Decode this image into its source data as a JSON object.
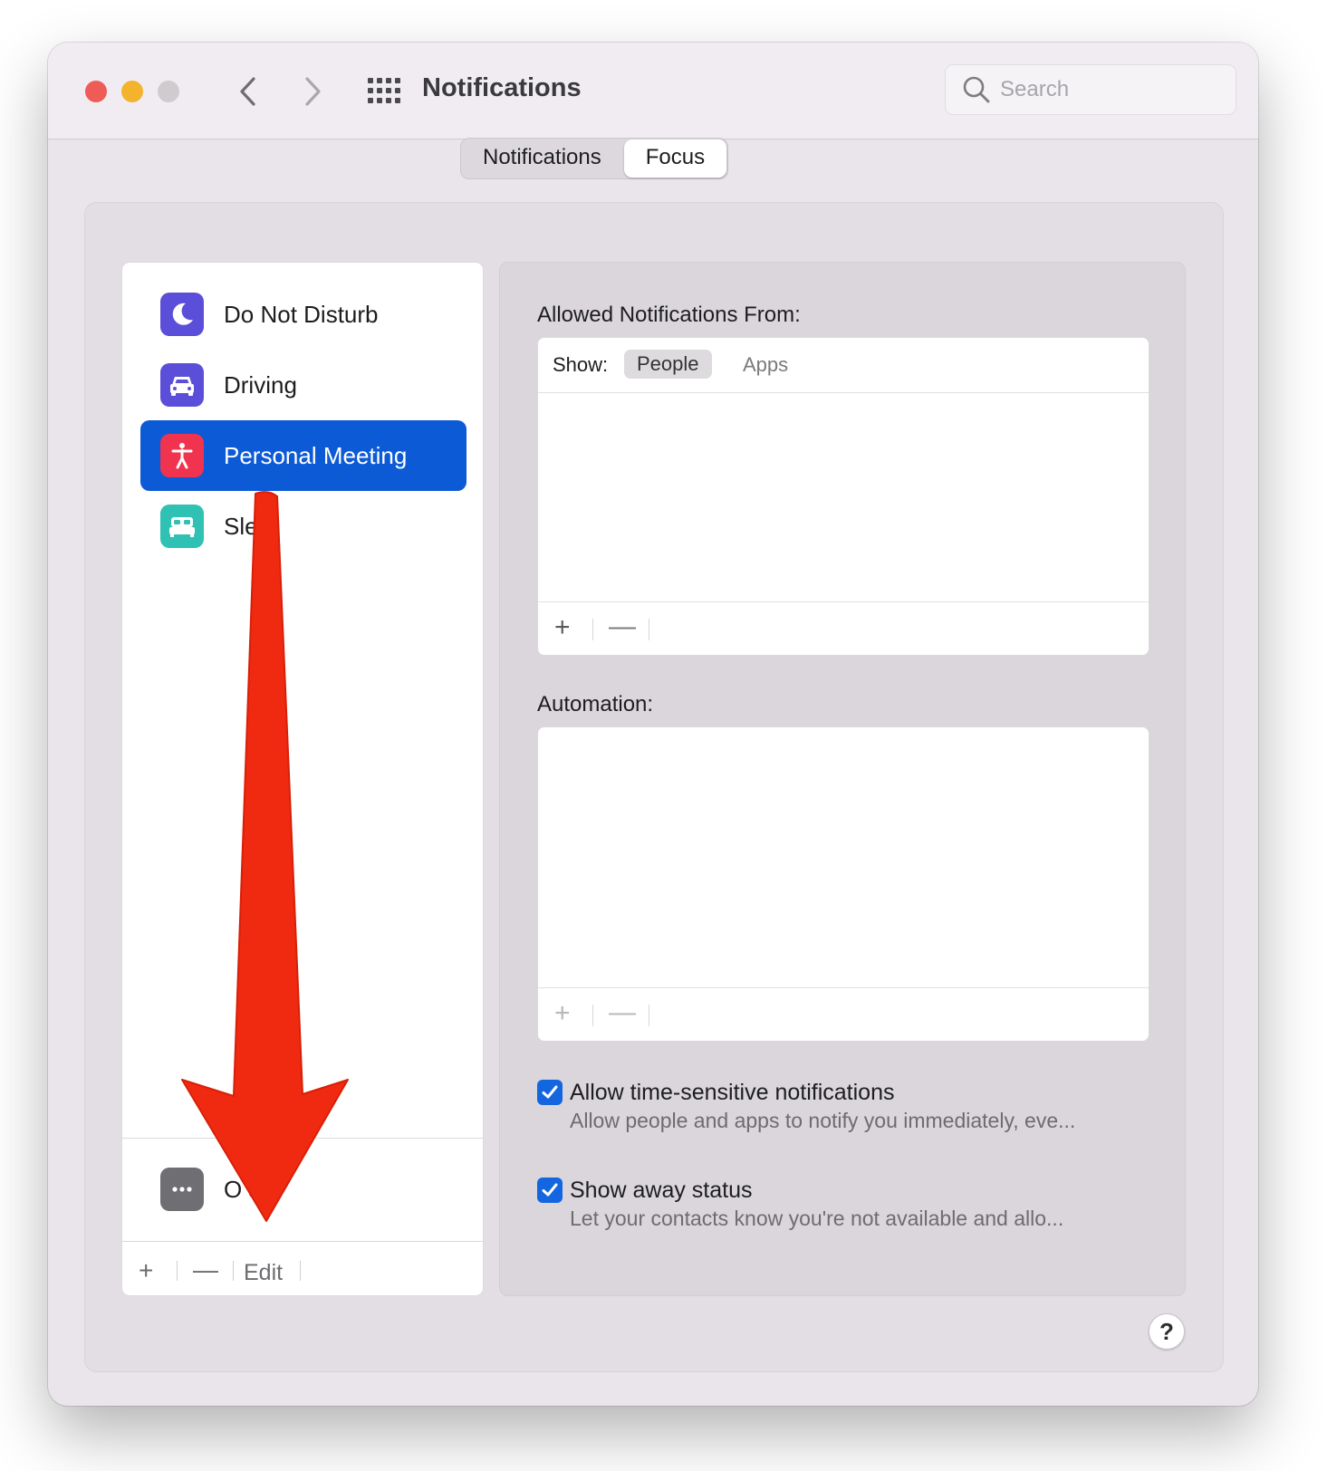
{
  "window": {
    "title": "Notifications",
    "search_placeholder": "Search"
  },
  "tabs": [
    {
      "label": "Notifications",
      "active": false
    },
    {
      "label": "Focus",
      "active": true
    }
  ],
  "sidebar": {
    "items": [
      {
        "label": "Do Not Disturb",
        "icon": "moon-icon",
        "color": "#5b4fd9"
      },
      {
        "label": "Driving",
        "icon": "car-icon",
        "color": "#5b4fd9"
      },
      {
        "label": "Personal Meeting",
        "icon": "person-icon",
        "color": "#f0334f",
        "selected": true
      },
      {
        "label": "Sle o",
        "icon": "bed-icon",
        "color": "#2fc1b4"
      }
    ],
    "options_item": {
      "label": "O s",
      "icon": "ellipsis-icon",
      "color": "#6f6f73"
    },
    "footer": {
      "add": "+",
      "remove": "—",
      "edit": "Edit"
    }
  },
  "allowed": {
    "title": "Allowed Notifications From:",
    "show_label": "Show:",
    "segments": [
      "People",
      "Apps"
    ],
    "selected_segment": "People",
    "add": "+",
    "remove": "—"
  },
  "automation": {
    "title": "Automation:",
    "add": "+",
    "remove": "—"
  },
  "options": [
    {
      "checked": true,
      "title": "Allow time-sensitive notifications",
      "description": "Allow people and apps to notify you immediately, eve..."
    },
    {
      "checked": true,
      "title": "Show away status",
      "description": "Let your contacts know you're not available and allo..."
    }
  ],
  "help": "?",
  "annotation": {
    "color": "#f02a10",
    "icon": "down-arrow-annotation"
  },
  "colors": {
    "accent": "#0d5ad6",
    "checkbox": "#1466e0"
  }
}
